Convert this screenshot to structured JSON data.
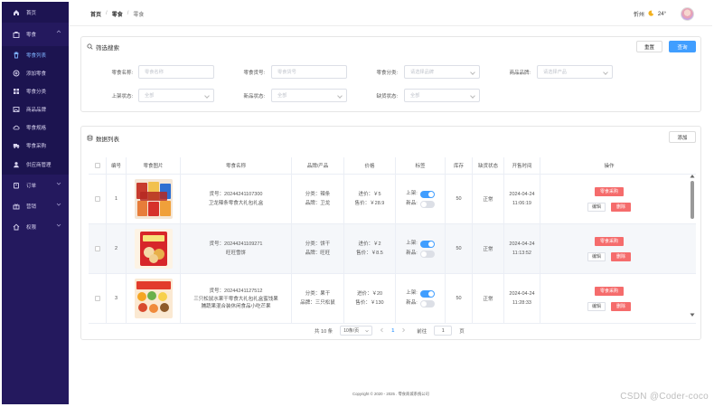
{
  "sidebar": {
    "items": [
      {
        "label": "首页",
        "icon": "home-icon"
      },
      {
        "label": "零食",
        "icon": "bag-icon",
        "expanded": true
      },
      {
        "label": "零食列表",
        "icon": "trash-icon",
        "active": true
      },
      {
        "label": "添加零食",
        "icon": "plus-circle-icon"
      },
      {
        "label": "零食分类",
        "icon": "grid-icon"
      },
      {
        "label": "商品品牌",
        "icon": "image-icon"
      },
      {
        "label": "零食规格",
        "icon": "cloud-icon"
      },
      {
        "label": "零食采购",
        "icon": "truck-icon"
      },
      {
        "label": "供应商管理",
        "icon": "user-icon"
      },
      {
        "label": "订单",
        "icon": "cart-icon"
      },
      {
        "label": "营销",
        "icon": "gift-icon"
      },
      {
        "label": "权限",
        "icon": "house-icon"
      }
    ]
  },
  "header": {
    "breadcrumb": [
      "首页",
      "零食",
      "零食"
    ],
    "separator": "/",
    "city": "忻州",
    "temperature": "24°"
  },
  "filter": {
    "title": "筛选搜索",
    "reset_label": "重置",
    "search_label": "查询",
    "fields": [
      {
        "label": "零食名称:",
        "placeholder": "零食名称",
        "dropdown": false
      },
      {
        "label": "零食货号:",
        "placeholder": "零食货号",
        "dropdown": false
      },
      {
        "label": "零食分类:",
        "placeholder": "请选择品牌",
        "dropdown": true
      },
      {
        "label": "商品品牌:",
        "placeholder": "请选择产品",
        "dropdown": true
      },
      {
        "label": "上架状态:",
        "placeholder": "全部",
        "dropdown": true
      },
      {
        "label": "新品状态:",
        "placeholder": "全部",
        "dropdown": true
      },
      {
        "label": "缺货状态:",
        "placeholder": "全部",
        "dropdown": true
      }
    ]
  },
  "list": {
    "title": "数据列表",
    "add_label": "添加",
    "columns": [
      "编号",
      "零食图片",
      "零食名称",
      "品牌/产品",
      "价格",
      "标签",
      "库存",
      "缺货状态",
      "开售时间",
      "操作"
    ],
    "rows": [
      {
        "id": "1",
        "sku": "货号：20244241107300",
        "name": "卫龙辣条零食大礼包礼盒",
        "category": "分类：辣条",
        "brand": "品牌：卫龙",
        "cost": "进价：￥5",
        "price": "售价：￥28.9",
        "on_shelf_label": "上架:",
        "on_shelf": true,
        "is_new_label": "新品:",
        "is_new": false,
        "stock": "50",
        "stock_status": "正常",
        "date": "2024-04-24",
        "time": "11:06:19",
        "purchase_label": "零食采购",
        "edit_label": "编辑",
        "delete_label": "删除",
        "image_colors": [
          "#c73b2e",
          "#f2c14e",
          "#2e6fd1",
          "#e77d3a"
        ]
      },
      {
        "id": "2",
        "sku": "货号：20244241109271",
        "name": "旺旺雪饼",
        "category": "分类：饼干",
        "brand": "品牌：旺旺",
        "cost": "进价：￥2",
        "price": "售价：￥8.5",
        "on_shelf_label": "上架:",
        "on_shelf": true,
        "is_new_label": "新品:",
        "is_new": false,
        "stock": "50",
        "stock_status": "正常",
        "date": "2024-04-24",
        "time": "11:13:52",
        "purchase_label": "零食采购",
        "edit_label": "编辑",
        "delete_label": "删除",
        "image_colors": [
          "#d7262a",
          "#f4d9a8",
          "#e8b04a",
          "#ffffff"
        ]
      },
      {
        "id": "3",
        "sku": "货号：20244241127512",
        "name": "三只松鼠水果干零食大礼包礼盒蜜饯果脯蔬果混合装休闲食品小吃芒果",
        "category": "分类：果干",
        "brand": "品牌：三只松鼠",
        "cost": "进价：￥20",
        "price": "售价：￥130",
        "on_shelf_label": "上架:",
        "on_shelf": true,
        "is_new_label": "新品:",
        "is_new": false,
        "stock": "50",
        "stock_status": "正常",
        "date": "2024-04-24",
        "time": "11:28:33",
        "purchase_label": "零食采购",
        "edit_label": "编辑",
        "delete_label": "删除",
        "image_colors": [
          "#e23b2b",
          "#f5a623",
          "#6ab04c",
          "#f7d04c"
        ]
      }
    ]
  },
  "pagination": {
    "total": "共 10 条",
    "page_size": "10条/页",
    "current_page": "1",
    "goto_label": "前往",
    "goto_value": "1",
    "page_suffix": "页"
  },
  "footer": {
    "text": "Copyright © 2020 - 2025 . 零食商城系统公司"
  },
  "watermark": "CSDN @Coder-coco",
  "colors": {
    "sidebar": "#24195e",
    "primary": "#409eff",
    "danger": "#f56c6c"
  }
}
